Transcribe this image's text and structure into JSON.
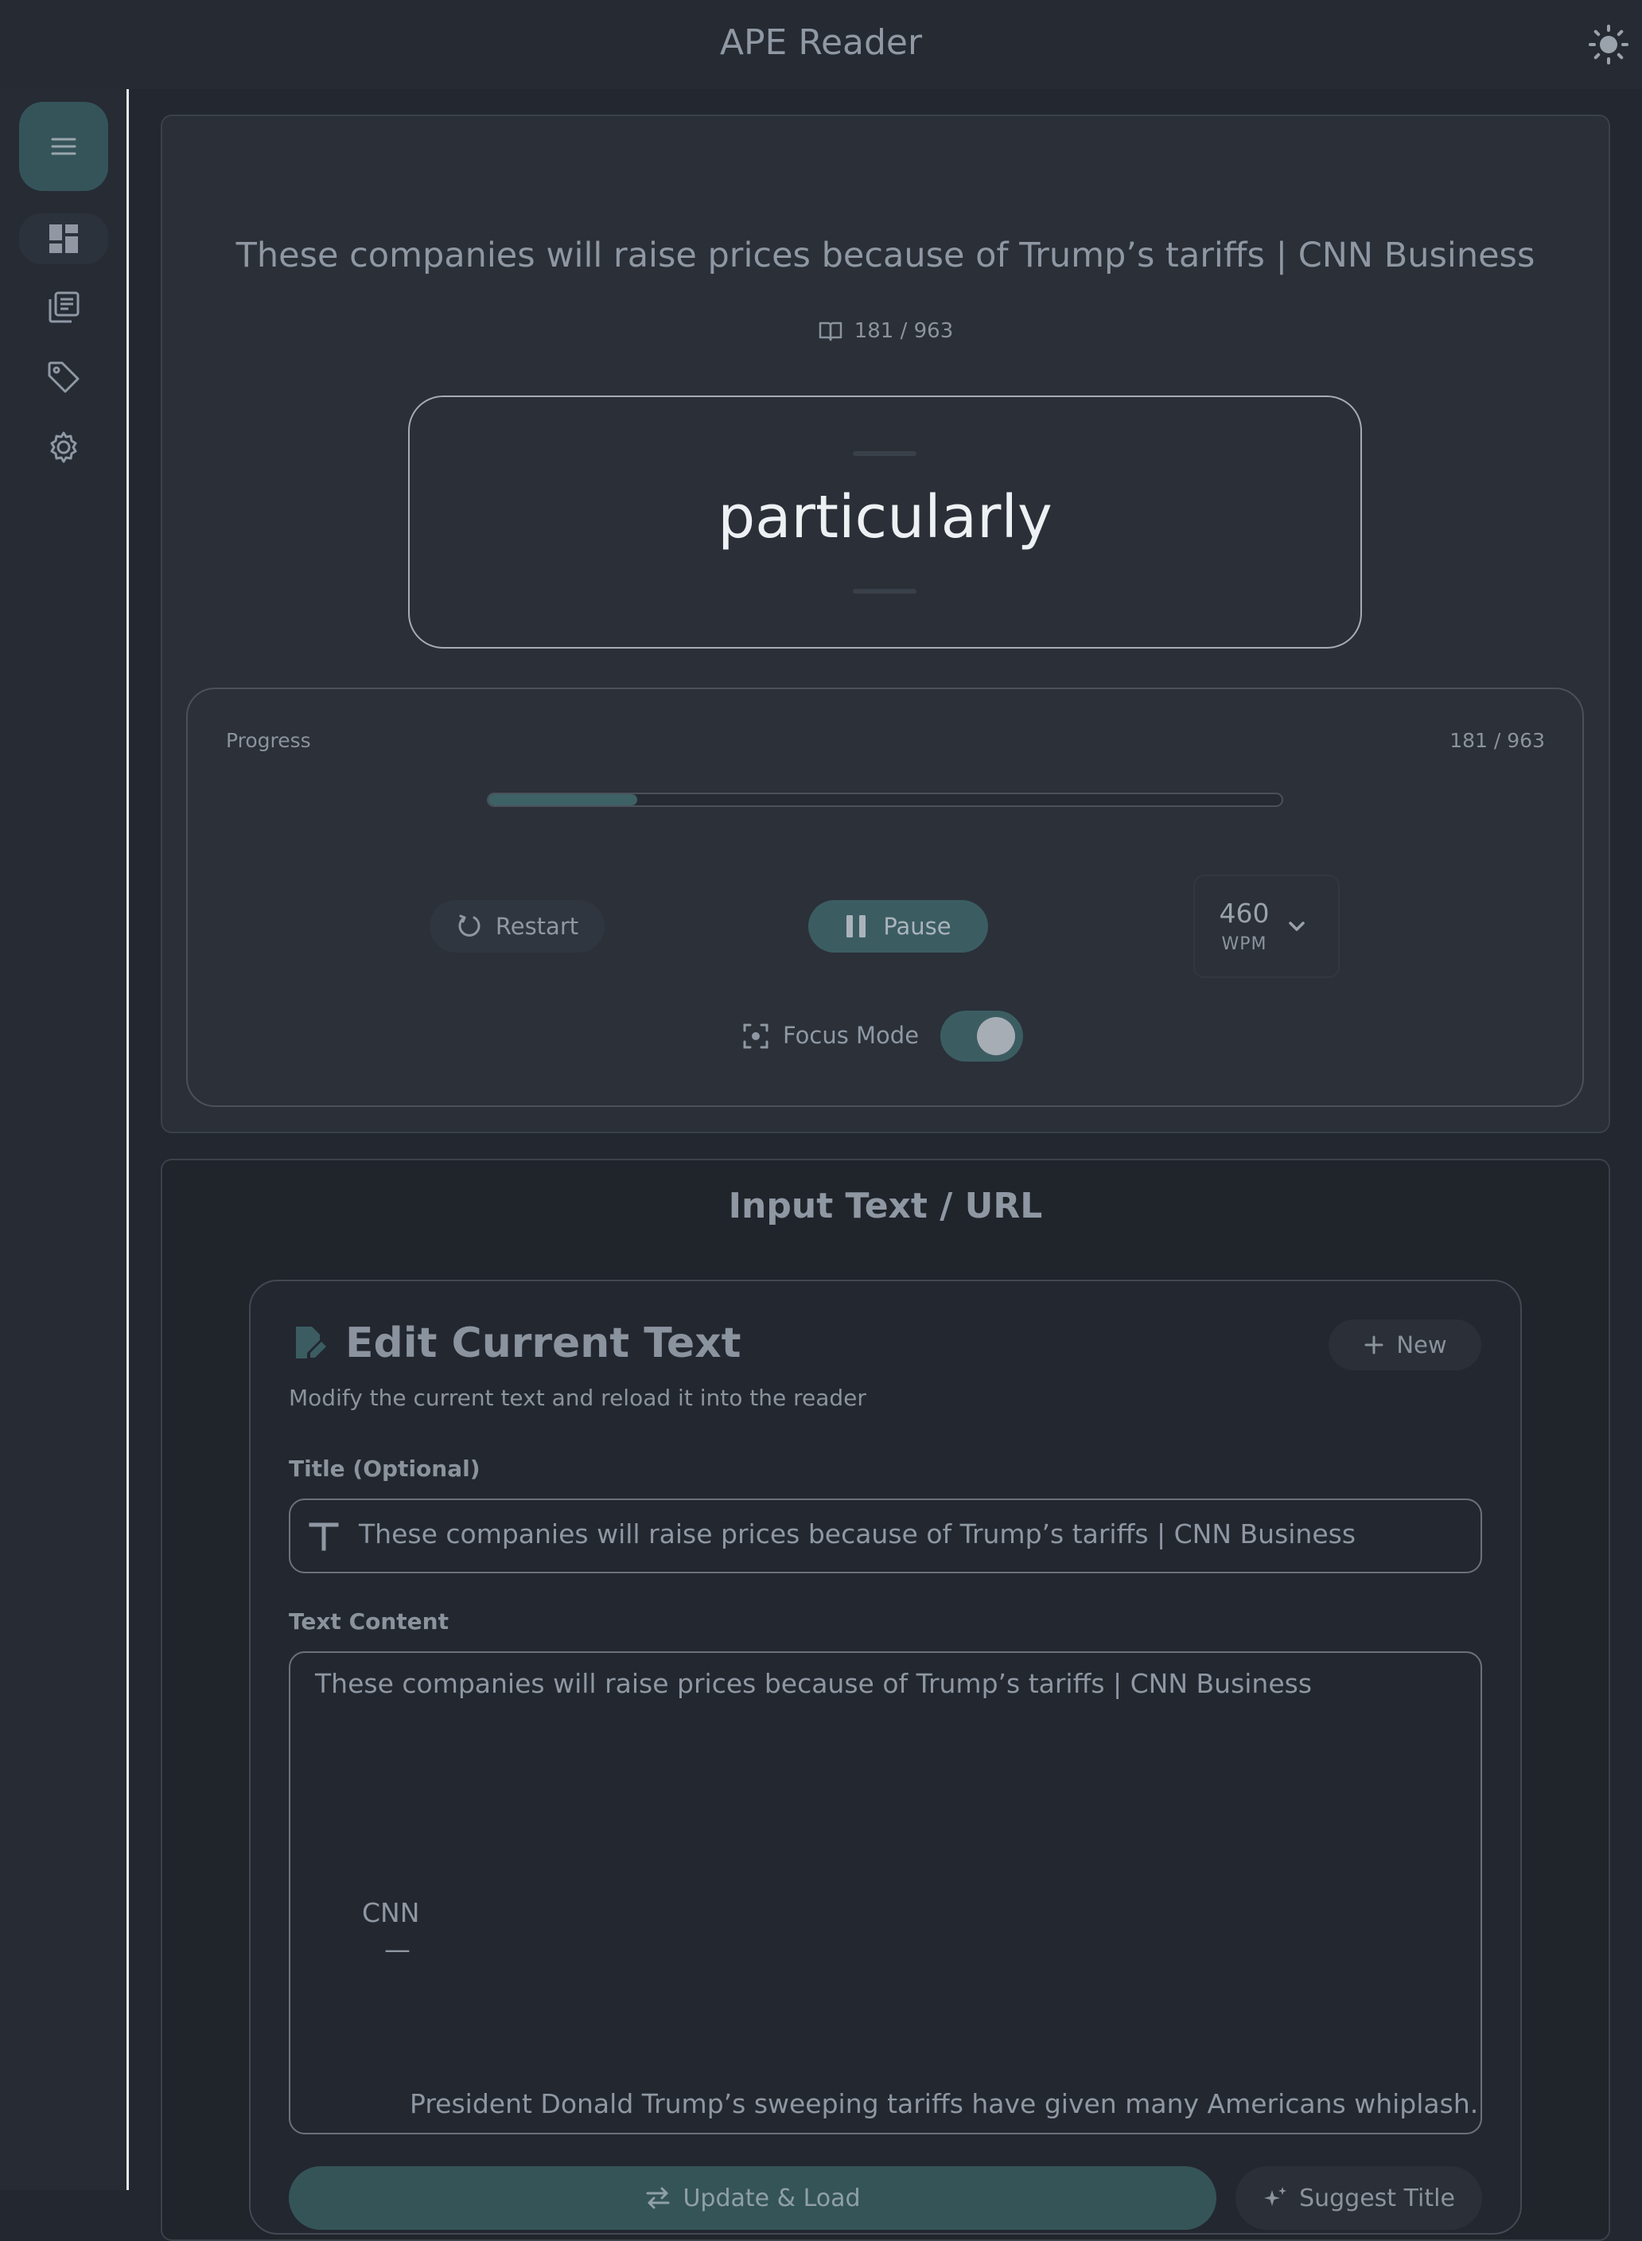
{
  "app": {
    "title": "APE Reader",
    "theme_icon": "sun-icon"
  },
  "sidebar": {
    "menu_icon": "menu-icon",
    "items": [
      {
        "id": "dashboard",
        "icon": "dashboard-icon",
        "active": true
      },
      {
        "id": "library",
        "icon": "library-icon",
        "active": false
      },
      {
        "id": "tags",
        "icon": "tag-icon",
        "active": false
      },
      {
        "id": "settings",
        "icon": "gear-icon",
        "active": false
      }
    ]
  },
  "reader": {
    "article_title": "These companies will raise prices because of Trump’s tariffs | CNN Business",
    "word_position": "181 / 963",
    "current_word": "particularly"
  },
  "controls": {
    "progress_label": "Progress",
    "progress_count": "181 / 963",
    "progress_fraction": 0.188,
    "restart_label": "Restart",
    "pause_label": "Pause",
    "wpm_value": "460",
    "wpm_unit": "WPM",
    "focus_mode_label": "Focus Mode",
    "focus_mode_on": true
  },
  "input": {
    "heading": "Input Text / URL",
    "edit_title": "Edit Current Text",
    "new_label": "New",
    "subtitle": "Modify the current text and reload it into the reader",
    "title_label": "Title (Optional)",
    "title_value": "These companies will raise prices because of Trump’s tariffs | CNN Business",
    "content_label": "Text Content",
    "content_lines": [
      "These companies will raise prices because of Trump’s tariffs | CNN Business",
      "CNN",
      "—",
      "President Donald Trump’s sweeping tariffs have given many Americans whiplash."
    ],
    "update_label": "Update & Load",
    "suggest_label": "Suggest Title"
  },
  "colors": {
    "accent": "#3b5d62",
    "background": "#232730",
    "card": "#2a2f38"
  }
}
